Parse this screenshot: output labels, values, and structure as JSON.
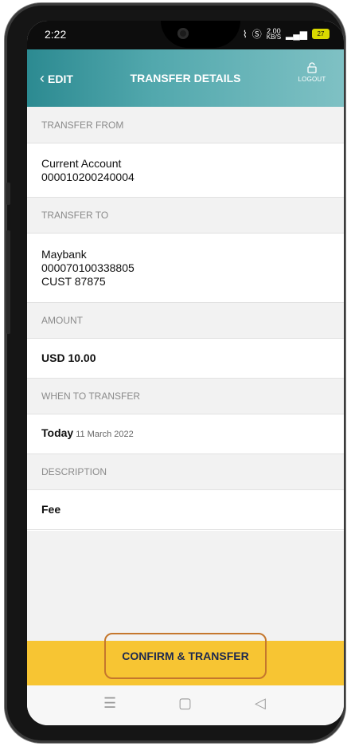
{
  "status_bar": {
    "time": "2:22",
    "speed_value": "2.00",
    "speed_unit": "KB/S",
    "battery": "27"
  },
  "header": {
    "back_label": "EDIT",
    "title": "TRANSFER DETAILS",
    "logout_label": "LOGOUT"
  },
  "sections": {
    "from_label": "TRANSFER FROM",
    "from_name": "Current Account",
    "from_number": "000010200240004",
    "to_label": "TRANSFER TO",
    "to_bank": "Maybank",
    "to_number": "000070100338805",
    "to_name": "CUST 87875",
    "amount_label": "AMOUNT",
    "amount_value": "USD 10.00",
    "when_label": "WHEN TO TRANSFER",
    "when_value": "Today",
    "when_date": "11 March 2022",
    "desc_label": "DESCRIPTION",
    "desc_value": "Fee"
  },
  "confirm_label": "CONFIRM & TRANSFER",
  "colors": {
    "header": "#4fa6ab",
    "confirm": "#f7c533",
    "highlight": "#c5772d"
  },
  "icons": [
    "wifi-icon",
    "shield-icon",
    "signal-icon",
    "battery-icon",
    "lock-icon",
    "menu-icon",
    "home-icon",
    "back-icon"
  ]
}
